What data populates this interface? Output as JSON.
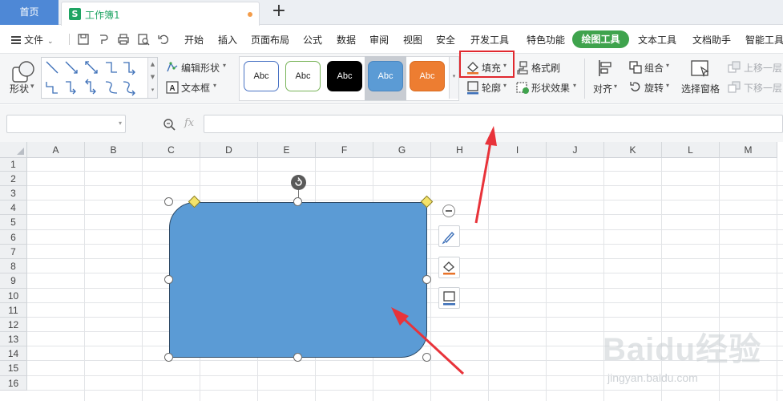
{
  "tabs": {
    "home": "首页",
    "doc_badge": "S",
    "doc_name": "工作簿1",
    "add": "+"
  },
  "menu": {
    "file": "文件",
    "items": [
      "开始",
      "插入",
      "页面布局",
      "公式",
      "数据",
      "审阅",
      "视图",
      "安全",
      "开发工具",
      "特色功能"
    ],
    "active": "绘图工具",
    "after": [
      "文本工具",
      "文档助手",
      "智能工具"
    ]
  },
  "ribbon": {
    "shapes_label": "形状",
    "edit_shape": "编辑形状",
    "text_box": "文本框",
    "style_samples": [
      {
        "label": "Abc",
        "fill": "#ffffff",
        "border": "#4a73c4",
        "text": "#222222"
      },
      {
        "label": "Abc",
        "fill": "#ffffff",
        "border": "#79b45a",
        "text": "#222222"
      },
      {
        "label": "Abc",
        "fill": "#000000",
        "border": "#000000",
        "text": "#ffffff"
      },
      {
        "label": "Abc",
        "fill": "#5b9bd5",
        "border": "#4a86c0",
        "text": "#ffffff"
      },
      {
        "label": "Abc",
        "fill": "#ed7d31",
        "border": "#d96c22",
        "text": "#ffffff"
      }
    ],
    "fill": "填充",
    "outline": "轮廓",
    "format_painter": "格式刷",
    "shape_effects": "形状效果",
    "align": "对齐",
    "group": "组合",
    "rotate": "旋转",
    "selection_pane": "选择窗格",
    "bring_forward": "上移一层",
    "send_backward": "下移一层"
  },
  "formula": {
    "fx": "fx"
  },
  "sheet": {
    "columns": [
      "A",
      "B",
      "C",
      "D",
      "E",
      "F",
      "G",
      "H",
      "I",
      "J",
      "K",
      "L",
      "M"
    ],
    "rows": [
      "1",
      "2",
      "3",
      "4",
      "5",
      "6",
      "7",
      "8",
      "9",
      "10",
      "11",
      "12",
      "13",
      "14",
      "15",
      "16"
    ]
  },
  "shape": {
    "fill_color": "#5b9bd5",
    "type": "rounded-diagonal-rectangle"
  },
  "colors": {
    "accent_green": "#3fa34d",
    "home_tab_blue": "#4e88d6",
    "highlight_red": "#e0282e"
  },
  "watermark": {
    "text": "Baidu经验",
    "sub": "jingyan.baidu.com"
  }
}
